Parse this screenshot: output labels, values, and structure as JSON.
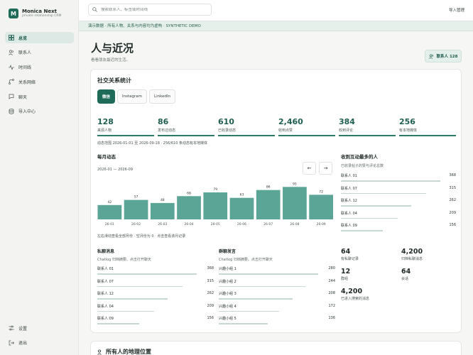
{
  "brand": {
    "initial": "M",
    "name": "Monica Next",
    "subtitle": "private relationship CRM"
  },
  "nav": {
    "items": [
      {
        "label": "总览",
        "active": true
      },
      {
        "label": "联系人"
      },
      {
        "label": "时间线"
      },
      {
        "label": "关系网络"
      },
      {
        "label": "聊天"
      },
      {
        "label": "导入中心"
      }
    ],
    "bottom": [
      {
        "label": "设置"
      },
      {
        "label": "退出"
      }
    ]
  },
  "topbar": {
    "search_placeholder": "搜索联系人、标签或时间线",
    "import_label": "导入管理"
  },
  "banner": "演示数据 · 所有人物、关系与内容均为虚构 · SYNTHETIC DEMO",
  "page": {
    "title": "人与近况",
    "subtitle": "看看朋友最近的生活。",
    "contact_chip": "联系人 128"
  },
  "social": {
    "title": "社交关系统计",
    "tabs": [
      "微信",
      "Instagram",
      "LinkedIn"
    ],
    "active_tab": 0,
    "stats": [
      {
        "value": "128",
        "label": "来源人物"
      },
      {
        "value": "86",
        "label": "发布过动态"
      },
      {
        "value": "610",
        "label": "已收录动态"
      },
      {
        "value": "2,460",
        "label": "收到点赞"
      },
      {
        "value": "384",
        "label": "收到评论"
      },
      {
        "value": "256",
        "label": "有本地媒体"
      }
    ],
    "range_note": "动态范围 2026-01-01 至 2026-09-18 · 256/610 条动态有本地媒体",
    "monthly_title": "每月动态",
    "monthly_range": "2026-01 — 2026-09",
    "prev": "←",
    "next": "→",
    "chart_note": "左右滑动查看全部月份 · 空月份为 0 · 点击查看该月记录"
  },
  "chart_data": {
    "type": "bar",
    "categories": [
      "26-01",
      "26-02",
      "26-03",
      "26-04",
      "26-05",
      "26-06",
      "26-07",
      "26-08",
      "26-09"
    ],
    "values": [
      42,
      57,
      48,
      68,
      79,
      63,
      86,
      95,
      72
    ],
    "title": "每月动态",
    "color": "#5aa596"
  },
  "interactions": {
    "title": "收到互动最多的人",
    "subtitle": "已收录帖子的赞与评论总数",
    "rows": [
      {
        "name": "联系人 01",
        "value": 368,
        "ratio": 1.0
      },
      {
        "name": "联系人 07",
        "value": 315,
        "ratio": 0.86
      },
      {
        "name": "联系人 12",
        "value": 262,
        "ratio": 0.71
      },
      {
        "name": "联系人 04",
        "value": 209,
        "ratio": 0.57
      },
      {
        "name": "联系人 09",
        "value": 156,
        "ratio": 0.42
      }
    ]
  },
  "private_chats": {
    "title": "私聊消息",
    "subtitle": "Chatlog 归档摘要。点击打开聊天",
    "rows": [
      {
        "name": "联系人 01",
        "value": 368,
        "ratio": 1.0
      },
      {
        "name": "联系人 07",
        "value": 315,
        "ratio": 0.86
      },
      {
        "name": "联系人 12",
        "value": 262,
        "ratio": 0.71
      },
      {
        "name": "联系人 04",
        "value": 209,
        "ratio": 0.57
      },
      {
        "name": "联系人 09",
        "value": 156,
        "ratio": 0.42
      }
    ]
  },
  "group_chats": {
    "title": "群聊发言",
    "subtitle": "Chatlog 归档摘要。点击打开聊天",
    "rows": [
      {
        "name": "兴趣小组 1",
        "value": 280,
        "ratio": 1.0
      },
      {
        "name": "兴趣小组 2",
        "value": 244,
        "ratio": 0.87
      },
      {
        "name": "兴趣小组 3",
        "value": 208,
        "ratio": 0.74
      },
      {
        "name": "兴趣小组 4",
        "value": 172,
        "ratio": 0.61
      },
      {
        "name": "兴趣小组 5",
        "value": 136,
        "ratio": 0.49
      }
    ]
  },
  "mini_stats": [
    {
      "value": "64",
      "label": "有私聊记录"
    },
    {
      "value": "4,200",
      "label": "归档私聊消息"
    },
    {
      "value": "12",
      "label": "群组"
    },
    {
      "value": "64",
      "label": "会话"
    },
    {
      "value": "4,200",
      "label": "已进入搜索的消息"
    }
  ],
  "geo": {
    "title": "所有人的地理位置"
  }
}
